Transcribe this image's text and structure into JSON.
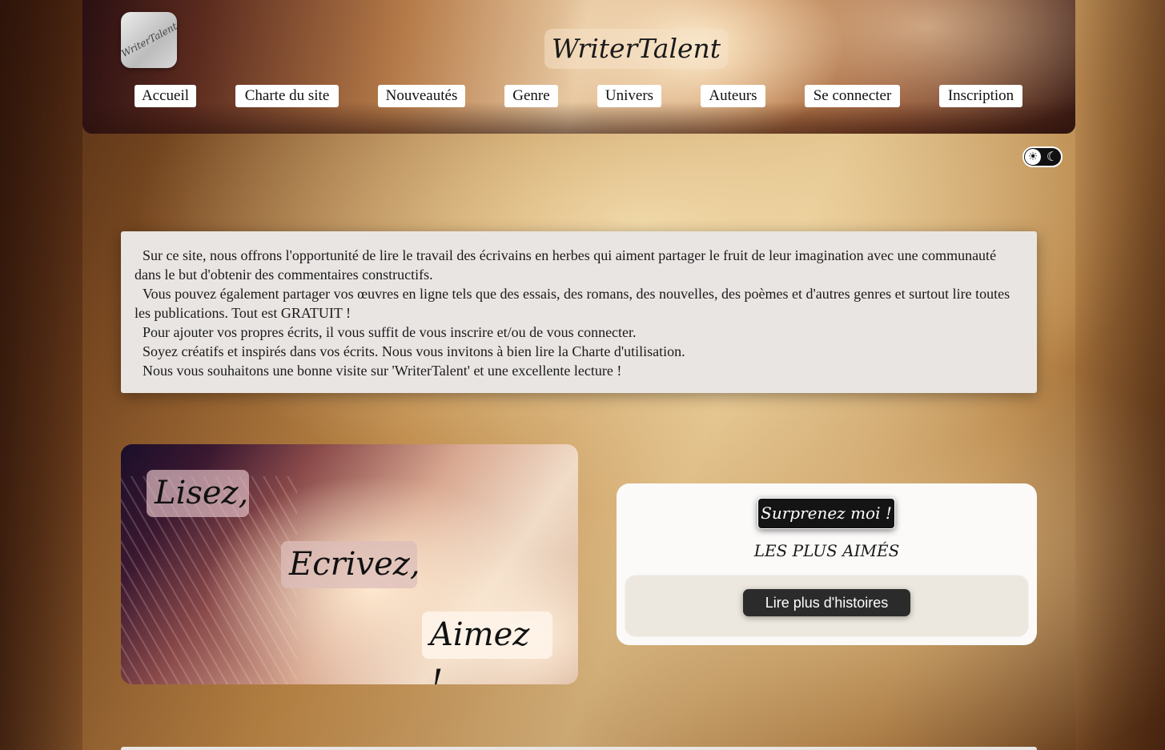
{
  "header": {
    "logo_text": "WriterTalent",
    "site_title": "WriterTalent"
  },
  "nav": [
    {
      "label": "Accueil"
    },
    {
      "label": "Charte du site"
    },
    {
      "label": "Nouveautés"
    },
    {
      "label": "Genre"
    },
    {
      "label": "Univers"
    },
    {
      "label": "Auteurs"
    },
    {
      "label": "Se connecter"
    },
    {
      "label": "Inscription"
    }
  ],
  "theme_toggle": {
    "light_icon": "sun-icon",
    "dark_icon": "moon-icon",
    "sun_glyph": "☀",
    "moon_glyph": "☾"
  },
  "intro": {
    "paragraphs": [
      "Sur ce site, nous offrons l'opportunité de lire le travail des écrivains en herbes qui aiment partager le fruit de leur imagination avec une communauté dans le but d'obtenir des commentaires constructifs.",
      "Vous pouvez également partager vos œuvres en ligne tels que des essais, des romans, des nouvelles, des poèmes et d'autres genres et surtout lire toutes les publications. Tout est GRATUIT !",
      "Pour ajouter vos propres écrits, il vous suffit de vous inscrire et/ou de vous connecter.",
      "Soyez créatifs et inspirés dans vos écrits. Nous vous invitons à bien lire la Charte d'utilisation.",
      "Nous vous souhaitons une bonne visite sur 'WriterTalent' et une excellente lecture !"
    ]
  },
  "hero": {
    "word1": "Lisez,",
    "word2": "Ecrivez,",
    "word3": "Aimez !"
  },
  "panel": {
    "surprise_label": "Surprenez moi !",
    "most_liked_title": "LES PLUS AIMÉS",
    "more_stories_label": "Lire plus d'histoires"
  }
}
